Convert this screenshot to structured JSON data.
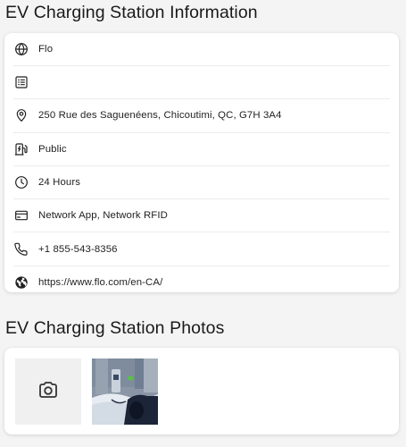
{
  "info_section": {
    "title": "EV Charging Station Information",
    "rows": [
      {
        "icon": "globe-icon",
        "text": "Flo"
      },
      {
        "icon": "list-icon",
        "text": ""
      },
      {
        "icon": "location-pin-icon",
        "text": "250 Rue des Saguenéens, Chicoutimi, QC, G7H 3A4"
      },
      {
        "icon": "ev-charger-icon",
        "text": "Public"
      },
      {
        "icon": "clock-icon",
        "text": "24 Hours"
      },
      {
        "icon": "credit-card-icon",
        "text": "Network App, Network RFID"
      },
      {
        "icon": "phone-icon",
        "text": "+1 855-543-8356"
      },
      {
        "icon": "earth-icon",
        "text": "https://www.flo.com/en-CA/"
      }
    ]
  },
  "photos_section": {
    "title": "EV Charging Station Photos",
    "items": [
      {
        "type": "add-photo",
        "icon": "camera-icon"
      },
      {
        "type": "photo",
        "alt": "charging station in snow"
      }
    ]
  },
  "colors": {
    "background": "#f4f4f4",
    "card": "#ffffff",
    "text": "#1b1b1b",
    "icon": "#222222"
  }
}
